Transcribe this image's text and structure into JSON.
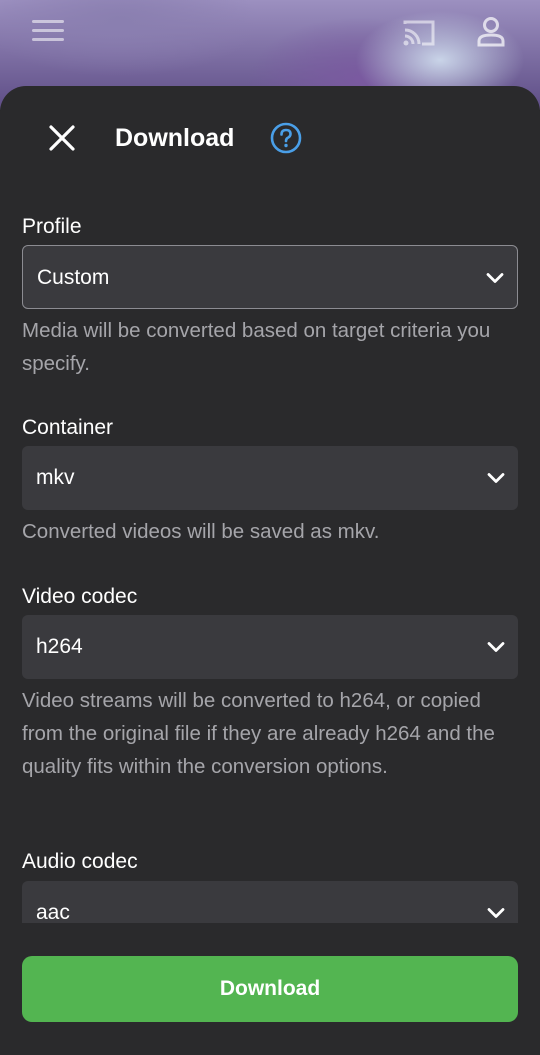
{
  "colors": {
    "sheet_bg": "#2a2a2c",
    "field_bg": "#3a3a3e",
    "help_text": "#a5a5aa",
    "accent_help": "#4a9fe8",
    "primary_button": "#53b551"
  },
  "header_icons": {
    "menu": "menu-icon",
    "cast": "cast-icon",
    "account": "account-icon"
  },
  "dialog": {
    "title": "Download",
    "close_icon": "close-icon",
    "help_icon": "help-circle-icon"
  },
  "fields": {
    "profile": {
      "label": "Profile",
      "value": "Custom",
      "help": "Media will be converted based on target criteria you specify."
    },
    "container": {
      "label": "Container",
      "value": "mkv",
      "help": "Converted videos will be saved as mkv."
    },
    "video_codec": {
      "label": "Video codec",
      "value": "h264",
      "help": "Video streams will be converted to h264, or copied from the original file if they are already h264 and the quality fits within the conversion options."
    },
    "audio_codec": {
      "label": "Audio codec",
      "value": "aac"
    }
  },
  "actions": {
    "download_label": "Download"
  }
}
